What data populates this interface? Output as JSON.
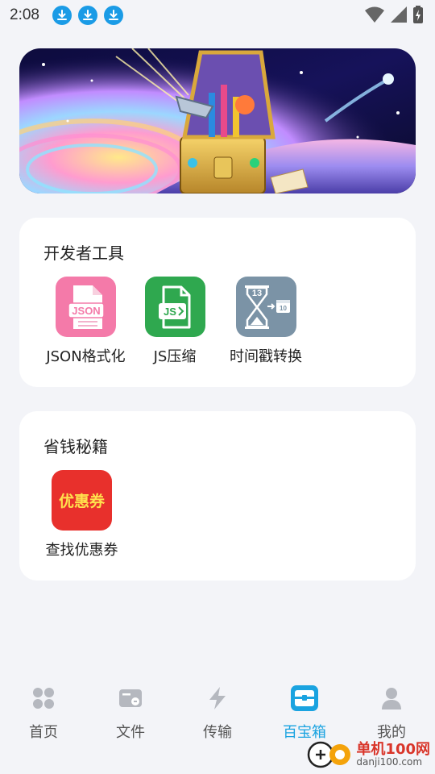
{
  "status_bar": {
    "time": "2:08",
    "icons": [
      "download-icon",
      "download-icon",
      "download-icon",
      "wifi-icon",
      "signal-icon",
      "battery-icon"
    ]
  },
  "banner": {
    "image": "treasure-chest-space-illustration"
  },
  "dev_tools": {
    "title": "开发者工具",
    "items": [
      {
        "label": "JSON格式化",
        "icon": "json-file-icon",
        "badge": "JSON",
        "color": "#f47aa9"
      },
      {
        "label": "JS压缩",
        "icon": "js-file-icon",
        "badge": "JS",
        "color": "#2fa84f"
      },
      {
        "label": "时间戳转换",
        "icon": "hourglass-calendar-icon",
        "badge_top": "13",
        "badge_cal": "10",
        "color": "#7b93a6"
      }
    ]
  },
  "money_tips": {
    "title": "省钱秘籍",
    "items": [
      {
        "label": "查找优惠券",
        "icon_text": "优惠券",
        "icon": "coupon-icon",
        "color": "#e8302c"
      }
    ]
  },
  "bottom_nav": {
    "items": [
      {
        "label": "首页",
        "icon": "grid-icon"
      },
      {
        "label": "文件",
        "icon": "folder-link-icon"
      },
      {
        "label": "传输",
        "icon": "lightning-icon"
      },
      {
        "label": "百宝箱",
        "icon": "toolbox-icon",
        "active": true
      },
      {
        "label": "我的",
        "icon": "person-icon"
      }
    ],
    "active_color": "#1aa3e0"
  },
  "watermark": {
    "cn": "单机100网",
    "en": "danji100.com"
  }
}
